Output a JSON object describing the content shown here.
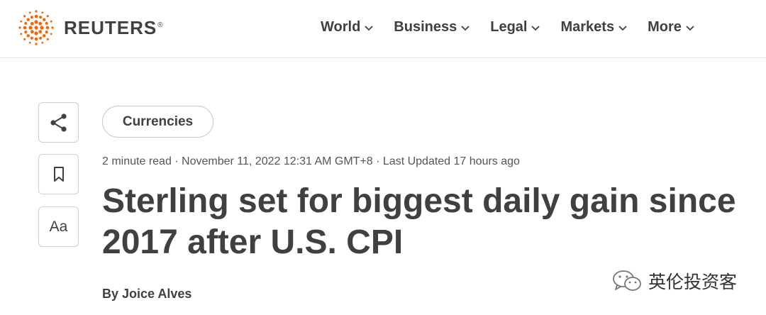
{
  "brand": {
    "name": "REUTERS",
    "reg_mark": "®",
    "accent": "#fa6400"
  },
  "nav": {
    "items": [
      "World",
      "Business",
      "Legal",
      "Markets",
      "More"
    ]
  },
  "article": {
    "tag": "Currencies",
    "meta": "2 minute read · November 11, 2022 12:31 AM GMT+8 · Last Updated 17 hours ago",
    "title": "Sterling set for biggest daily gain since 2017 after U.S. CPI",
    "byline": "By Joice Alves"
  },
  "side_actions": {
    "text_size_label": "Aa",
    "icons": [
      "share-icon",
      "bookmark-icon",
      "text-size-icon"
    ]
  },
  "watermark": {
    "text": "英伦投资客"
  }
}
